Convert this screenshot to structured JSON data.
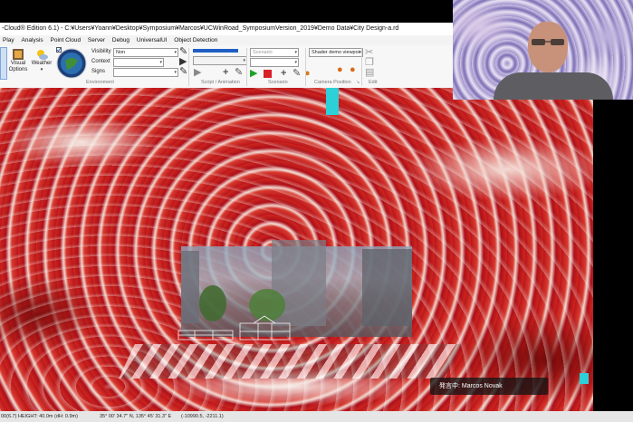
{
  "window": {
    "title": "-Cloud® Edition 6.1) - C:¥Users¥Yoann¥Desktop¥Symposium¥Marcos¥UCWinRoad_SymposiumVersion_2019¥Demo Data¥City Design-a.rd"
  },
  "menu": [
    "Play",
    "Analysis",
    "Point Cloud",
    "Server",
    "Debug",
    "UniversalUI",
    "Object Detection"
  ],
  "ribbon": {
    "visual_options_label": "Visual Options",
    "weather_label": "Weather",
    "visibility_label": "Visibility",
    "visibility_value": "Non",
    "context_label": "Context",
    "signs_label": "Signs",
    "environment_group": "Environment",
    "script_group": "Script / Animation",
    "scenario_group": "Scenario",
    "scenario_value": "Scenario",
    "camera_value": "Shader demo viewpoi",
    "camera_group": "Camera Position",
    "edit_group": "Edit"
  },
  "meeting": {
    "speaker_badge": "発言中: Marcos Novak"
  },
  "status": {
    "left": "00(6.7) HEIGHT: 40.0m (dH: 0.9m)",
    "coords": "35° 00' 34.7\" N, 135° 45' 31.3\" E",
    "xy": "(-10990.5, -2211.1)"
  },
  "colors": {
    "accent_blue": "#1f5fc4",
    "viewport_red": "#b01818",
    "highlight_cyan": "#2bd0d8"
  }
}
